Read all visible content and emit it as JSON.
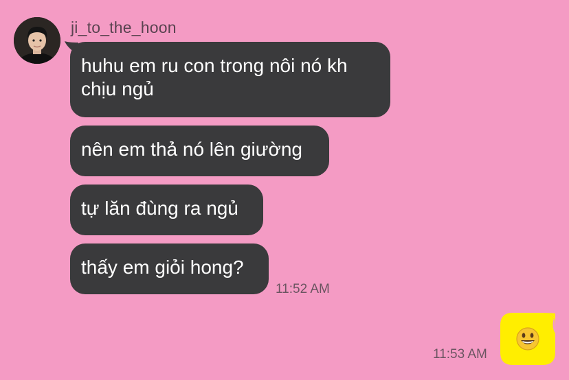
{
  "contact": {
    "username": "ji_to_the_hoon"
  },
  "messages": [
    {
      "text": "huhu em ru con trong nôi nó kh chịu ngủ"
    },
    {
      "text": "nên em thả nó lên giường"
    },
    {
      "text": "tự lăn đùng ra ngủ"
    },
    {
      "text": "thấy em giỏi hong?"
    }
  ],
  "timestamps": {
    "received": "11:52 AM",
    "sent": "11:53 AM"
  },
  "sent_message": {
    "icon": "smiling-face-emoji",
    "bubble_color": "#ffee00"
  },
  "colors": {
    "background": "#f49bc4",
    "incoming_bubble": "#3a3a3c"
  }
}
